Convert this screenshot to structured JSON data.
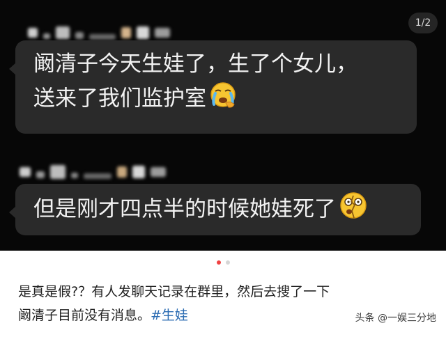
{
  "page_counter": "1/2",
  "messages": [
    {
      "lines": [
        "阚清子今天生娃了，生了个女儿，",
        "送来了我们监护室"
      ],
      "emoji": "crying-face-emoji"
    },
    {
      "lines": [
        "但是刚才四点半的时候她娃死了"
      ],
      "emoji": "shocked-face-emoji"
    }
  ],
  "carousel": {
    "current": 1,
    "total": 2
  },
  "caption": {
    "line1": "是真是假?？有人发聊天记录在群里，然后去搜了一下",
    "line2": "阚清子目前没有消息。",
    "hashtag": "#生娃"
  },
  "watermark": "头条 @一娱三分地"
}
